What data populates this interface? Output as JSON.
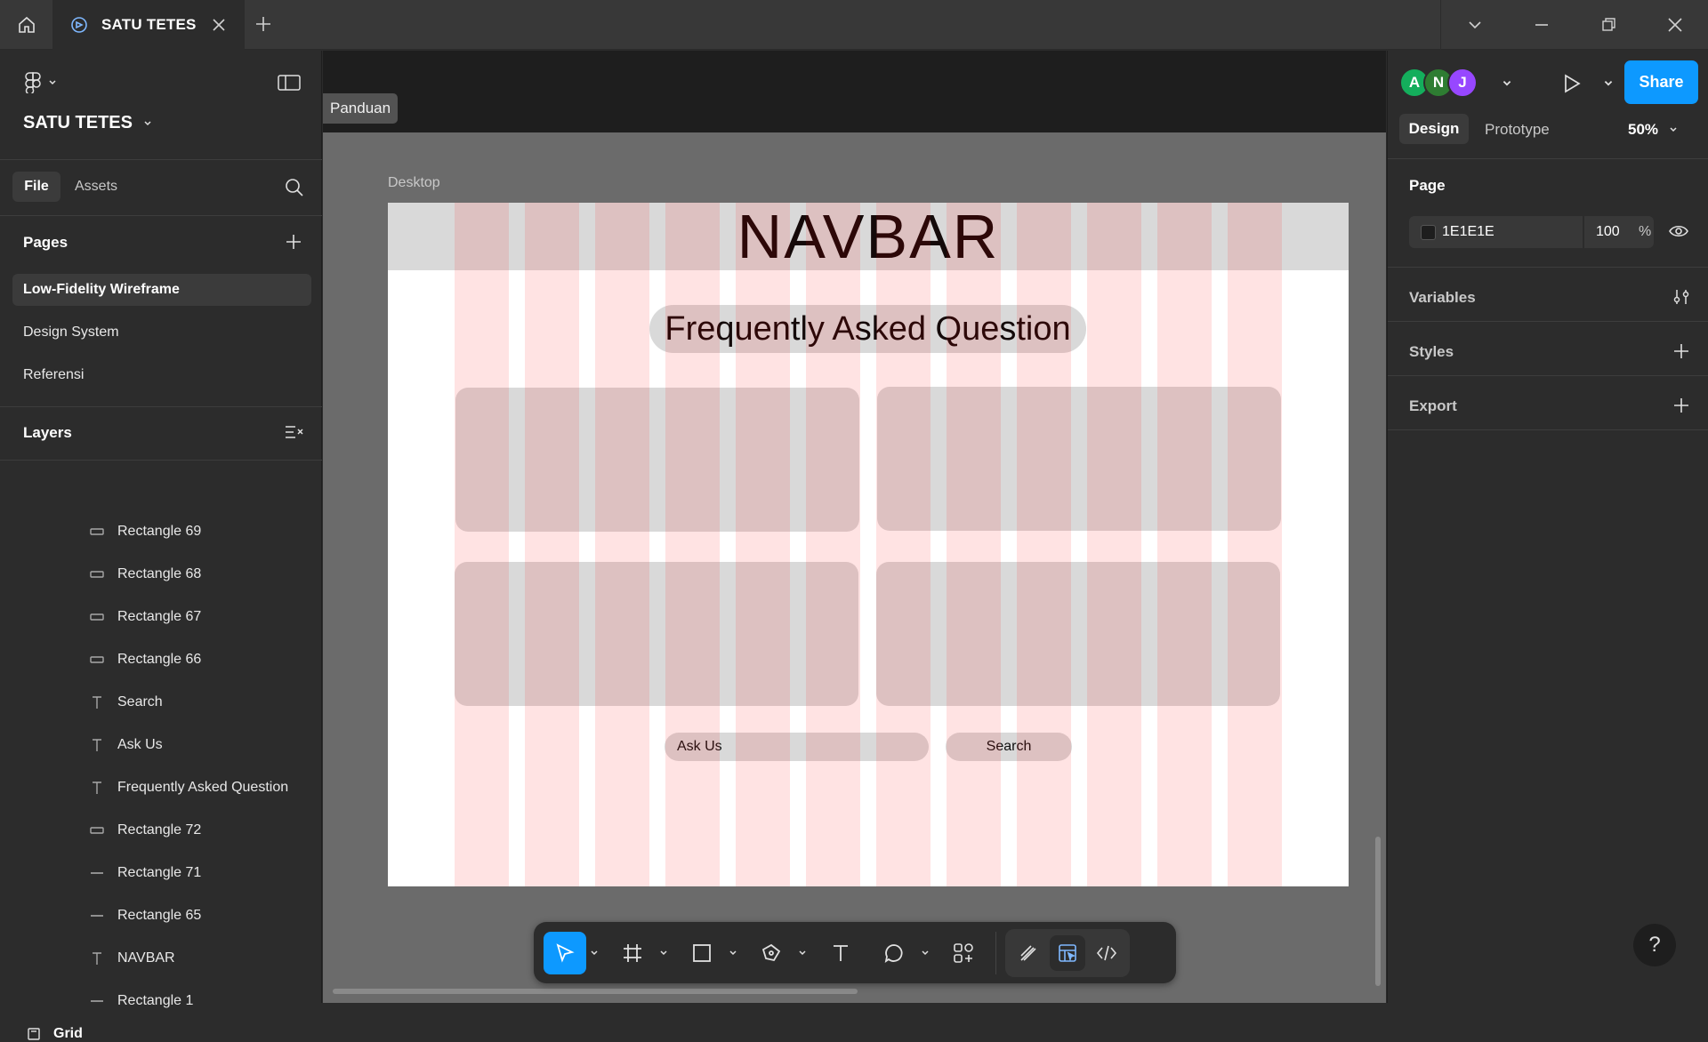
{
  "tabs": {
    "document_title": "SATU TETES"
  },
  "left_panel": {
    "file_name": "SATU TETES",
    "file_tab": "File",
    "assets_tab": "Assets",
    "pages_title": "Pages",
    "pages": [
      "Low-Fidelity Wireframe",
      "Design System",
      "Referensi"
    ],
    "layers_title": "Layers",
    "layers": [
      {
        "name": "Rectangle 69",
        "type": "rectangle"
      },
      {
        "name": "Rectangle 68",
        "type": "rectangle"
      },
      {
        "name": "Rectangle 67",
        "type": "rectangle"
      },
      {
        "name": "Rectangle 66",
        "type": "rectangle"
      },
      {
        "name": "Search",
        "type": "text"
      },
      {
        "name": "Ask Us",
        "type": "text"
      },
      {
        "name": "Frequently Asked Question",
        "type": "text"
      },
      {
        "name": "Rectangle 72",
        "type": "rectangle"
      },
      {
        "name": "Rectangle 71",
        "type": "line"
      },
      {
        "name": "Rectangle 65",
        "type": "line"
      },
      {
        "name": "NAVBAR",
        "type": "text"
      },
      {
        "name": "Rectangle 1",
        "type": "line"
      }
    ],
    "grid_layer": "Grid"
  },
  "canvas": {
    "panduan_label": "Panduan",
    "frame_label": "Desktop",
    "navbar_text": "NAVBAR",
    "faq_title": "Frequently Asked Question",
    "ask_us_label": "Ask Us",
    "search_label": "Search"
  },
  "right_panel": {
    "avatars": [
      {
        "initial": "A",
        "color": "#14ae5c"
      },
      {
        "initial": "N",
        "color": "#2e7d32"
      },
      {
        "initial": "J",
        "color": "#9747ff"
      }
    ],
    "share_label": "Share",
    "design_tab": "Design",
    "prototype_tab": "Prototype",
    "zoom": "50%",
    "page_section": "Page",
    "page_color_hex": "1E1E1E",
    "page_opacity": "100",
    "percent_sign": "%",
    "variables_section": "Variables",
    "styles_section": "Styles",
    "export_section": "Export",
    "help_label": "?"
  },
  "colors": {
    "accent": "#0d99ff",
    "panel_bg": "#2c2c2c",
    "canvas_bg": "#6b6b6b",
    "wireframe_gray": "#d9d9d9"
  }
}
